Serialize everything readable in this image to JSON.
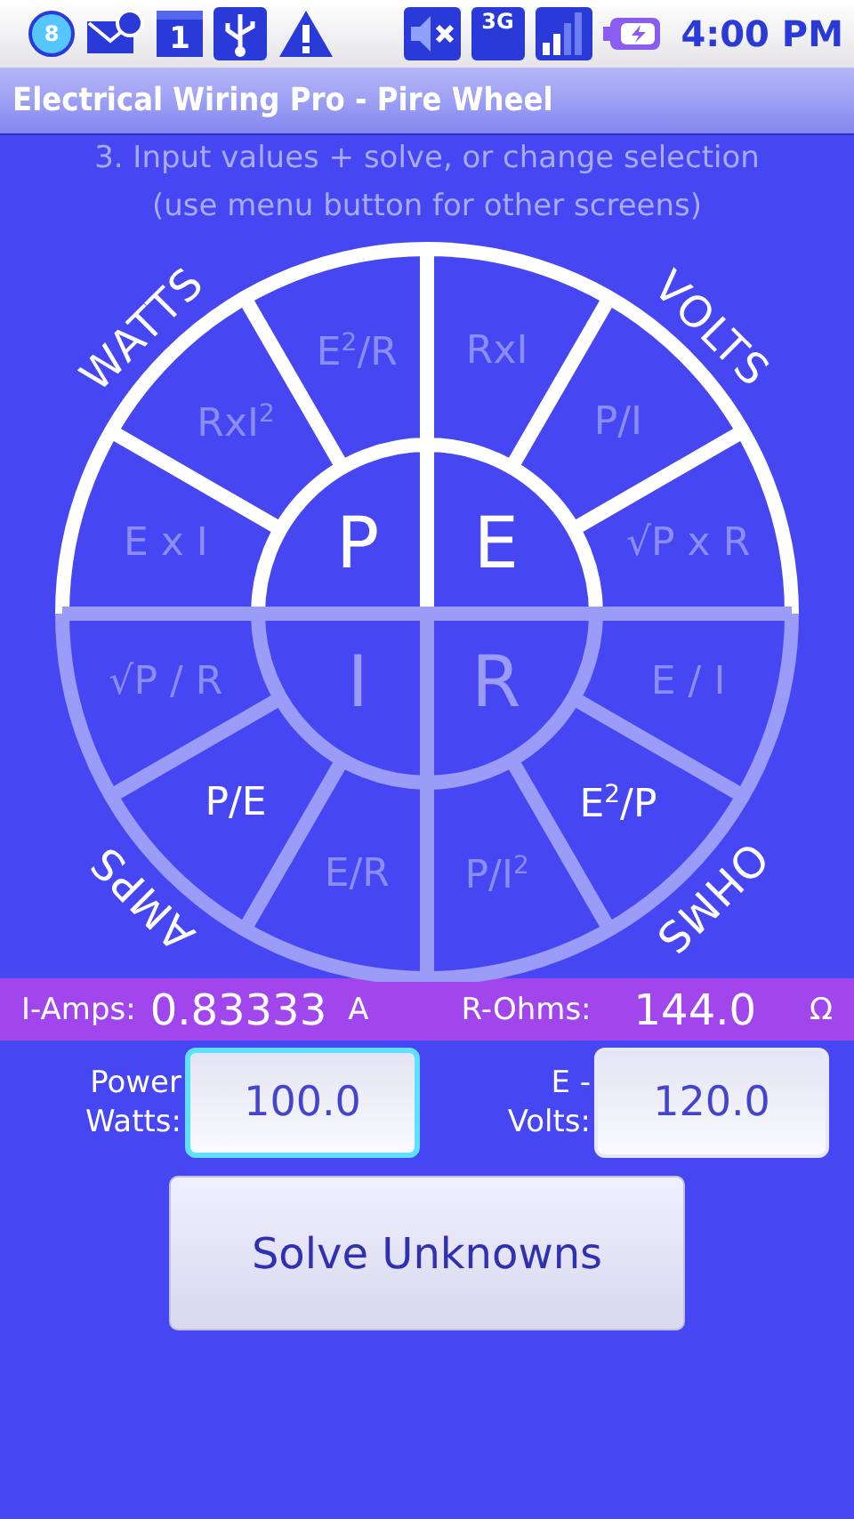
{
  "status_bar": {
    "notification_count": "8",
    "calendar_day": "1",
    "network": "3G",
    "time": "4:00 PM"
  },
  "title_bar": {
    "title": "Electrical Wiring Pro - Pire Wheel"
  },
  "instructions": [
    "3. Input values + solve, or change selection",
    "(use menu button for other screens)"
  ],
  "wheel": {
    "quadrants": [
      {
        "label": "WATTS",
        "center": "P",
        "active": true,
        "formulas": [
          {
            "text": "E$^{2}$/R",
            "selected": false
          },
          {
            "text": "RxI$^{2}$",
            "selected": false
          },
          {
            "text": "E x I",
            "selected": false
          }
        ]
      },
      {
        "label": "VOLTS",
        "center": "E",
        "active": true,
        "formulas": [
          {
            "text": "RxI",
            "selected": false
          },
          {
            "text": "P/I",
            "selected": false
          },
          {
            "text": "√P x R",
            "selected": false
          }
        ]
      },
      {
        "label": "AMPS",
        "center": "I",
        "active": false,
        "formulas": [
          {
            "text": "√P / R",
            "selected": false
          },
          {
            "text": "P/E",
            "selected": true
          },
          {
            "text": "E/R",
            "selected": false
          }
        ]
      },
      {
        "label": "OHMS",
        "center": "R",
        "active": false,
        "formulas": [
          {
            "text": "E / I",
            "selected": false
          },
          {
            "text": "E$^{2}$/P",
            "selected": true
          },
          {
            "text": "P/I$^{2}$",
            "selected": false
          }
        ]
      }
    ]
  },
  "results": [
    {
      "label": "I-Amps:",
      "value": "0.83333",
      "unit": "A"
    },
    {
      "label": "R-Ohms:",
      "value": "144.0",
      "unit": "Ω"
    }
  ],
  "inputs": [
    {
      "label": "Power\nWatts:",
      "value": "100.0",
      "focused": true
    },
    {
      "label": "E -\nVolts:",
      "value": "120.0",
      "focused": false
    }
  ],
  "solve_button": "Solve Unknowns"
}
